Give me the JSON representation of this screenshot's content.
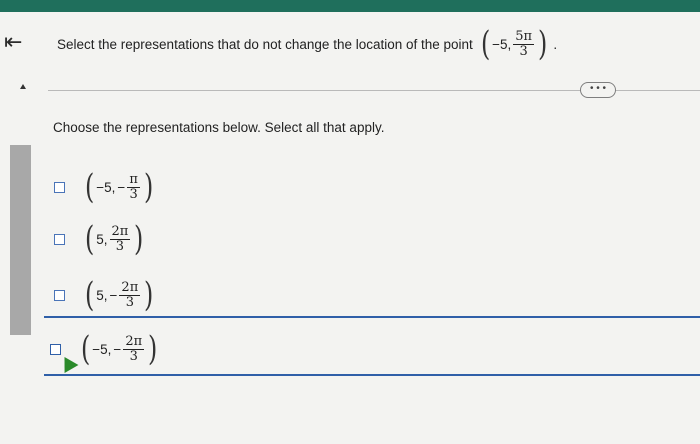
{
  "question": {
    "text": "Select the representations that do not change the location of the point",
    "point": {
      "r": "−5,",
      "num": "5π",
      "den": "3"
    },
    "end": "."
  },
  "more_button": {
    "label": "• • •"
  },
  "instruction": "Choose the representations below. Select all that apply.",
  "options": [
    {
      "r": "−5,",
      "sign": "−",
      "num": "π",
      "den": "3",
      "checked": false
    },
    {
      "r": "5,",
      "sign": "",
      "num": "2π",
      "den": "3",
      "checked": false
    },
    {
      "r": "5,",
      "sign": "−",
      "num": "2π",
      "den": "3",
      "checked": false
    },
    {
      "r": "−5,",
      "sign": "−",
      "num": "2π",
      "den": "3",
      "checked": false
    }
  ],
  "colors": {
    "top_bar": "#1f6f5c",
    "checkbox": "#4a74b8",
    "focus": "#2f5fa8",
    "cursor": "#2a8a2a"
  },
  "icons": {
    "back": "back-to-start-icon",
    "cursor": "cursor-icon"
  }
}
